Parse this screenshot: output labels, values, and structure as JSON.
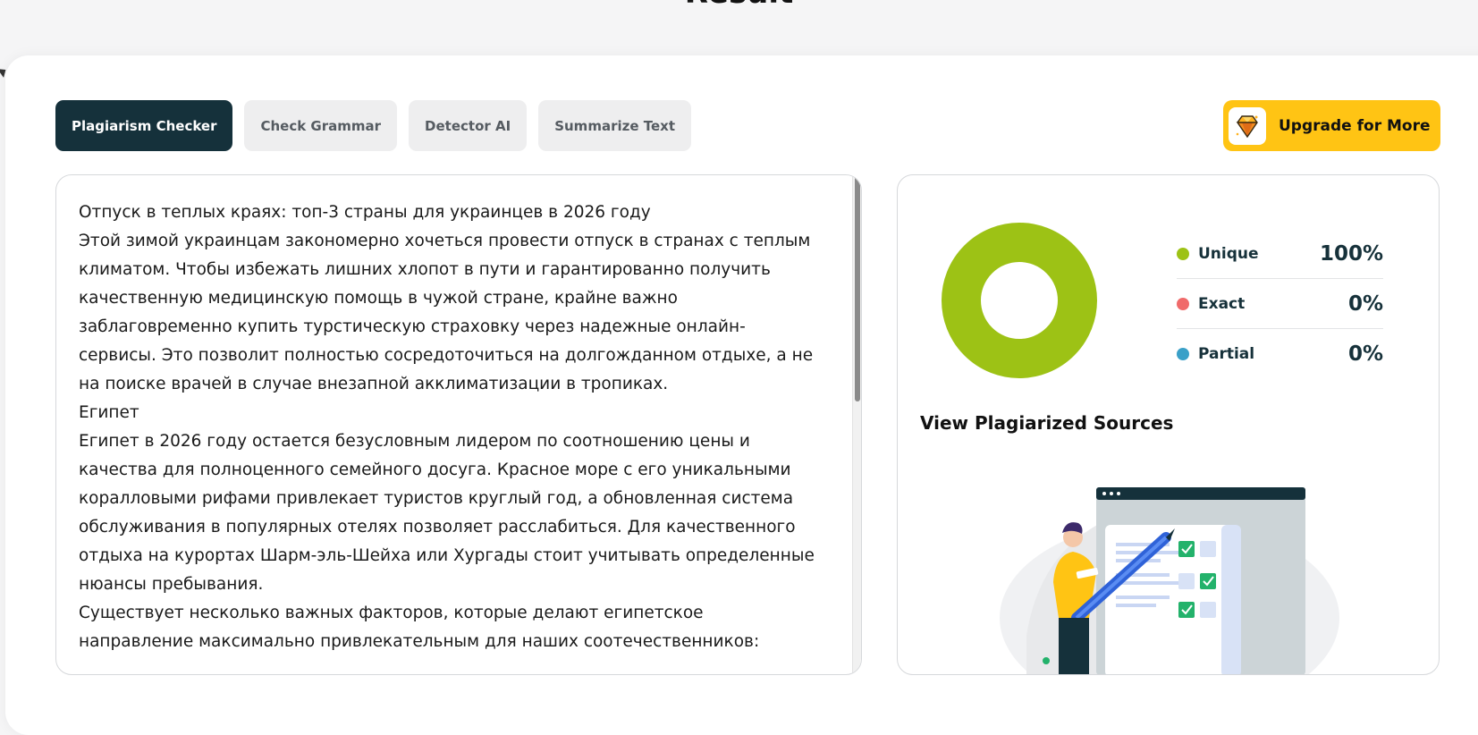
{
  "page": {
    "heading": "Result"
  },
  "tabs": [
    {
      "label": "Plagiarism Checker",
      "active": true
    },
    {
      "label": "Check Grammar",
      "active": false
    },
    {
      "label": "Detector AI",
      "active": false
    },
    {
      "label": "Summarize Text",
      "active": false
    }
  ],
  "upgrade": {
    "label": "Upgrade for More",
    "icon": "diamond-icon"
  },
  "editor": {
    "paragraphs": [
      "Отпуск в теплых краях: топ-3 страны для украинцев в 2026 году",
      "Этой зимой украинцам закономерно хочеться провести отпуск в странах с теплым климатом. Чтобы избежать лишних хлопот в пути и гарантированно получить качественную медицинскую помощь в чужой стране, крайне важно заблаговременно купить турстическую страховку через надежные онлайн-сервисы. Это позволит полностью сосредоточиться на долгожданном отдыхе, а не на поиске врачей в случае внезапной акклиматизации в тропиках.",
      "Египет",
      "Египет в 2026 году остается безусловным лидером по соотношению цены и качества для полноценного семейного досуга. Красное море с его уникальными коралловыми рифами привлекает туристов круглый год, а обновленная система обслуживания в популярных отелях позволяет расслабиться. Для качественного отдыха на курортах Шарм-эль-Шейха или Хургады стоит учитывать определенные нюансы пребывания.",
      "Существует несколько важных факторов, которые делают египетское направление максимально привлекательным для наших соотечественников:"
    ]
  },
  "results": {
    "legend": [
      {
        "label": "Unique",
        "value": "100%",
        "color": "#9dc215"
      },
      {
        "label": "Exact",
        "value": "0%",
        "color": "#f06a6a"
      },
      {
        "label": "Partial",
        "value": "0%",
        "color": "#3aa0c8"
      }
    ],
    "sources_link": "View Plagiarized Sources"
  },
  "chart_data": {
    "type": "pie",
    "categories": [
      "Unique",
      "Exact",
      "Partial"
    ],
    "values": [
      100,
      0,
      0
    ]
  },
  "colors": {
    "active_tab": "#15313b",
    "upgrade": "#ffc414",
    "unique": "#9dc215"
  }
}
